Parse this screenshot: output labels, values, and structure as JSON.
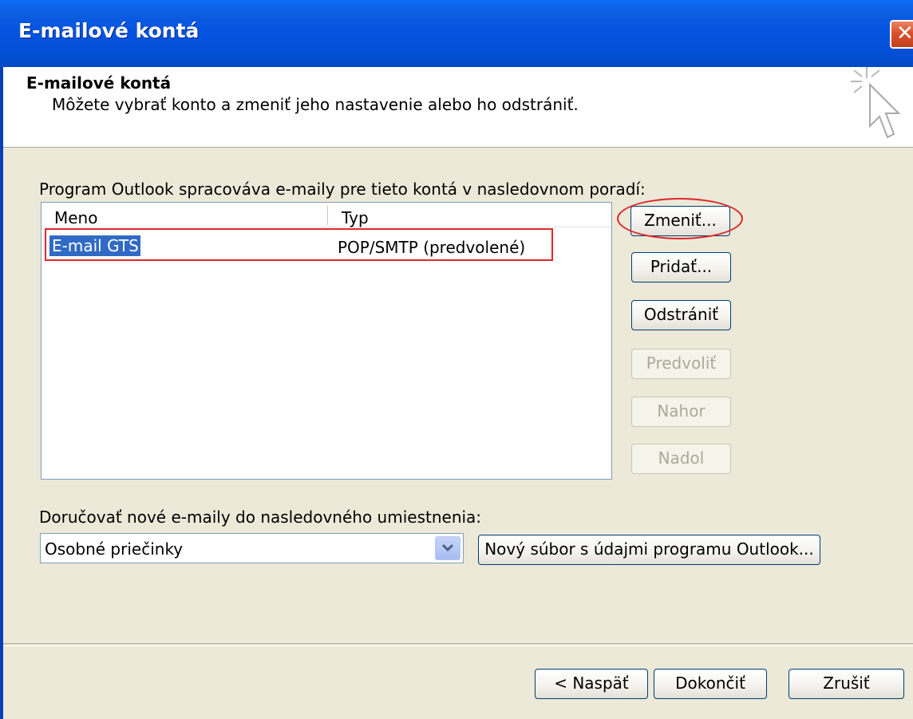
{
  "window": {
    "title": "E-mailové kontá"
  },
  "header": {
    "title": "E-mailové kontá",
    "subtitle": "Môžete vybrať konto a zmeniť jeho nastavenie alebo ho odstrániť."
  },
  "accounts": {
    "caption": "Program Outlook spracováva e-maily pre tieto kontá v nasledovnom poradí:",
    "columns": {
      "name": "Meno",
      "type": "Typ"
    },
    "rows": [
      {
        "name": "E-mail GTS",
        "type": "POP/SMTP (predvolené)",
        "selected": true
      }
    ]
  },
  "buttons": {
    "change": "Zmeniť...",
    "add": "Pridať...",
    "remove": "Odstrániť",
    "set_default": "Predvoliť",
    "up": "Nahor",
    "down": "Nadol"
  },
  "delivery": {
    "caption": "Doručovať nové e-maily do nasledovného umiestnenia:",
    "selected": "Osobné priečinky",
    "new_file_button": "Nový súbor s údajmi programu Outlook..."
  },
  "footer": {
    "back": "< Naspäť",
    "finish": "Dokončiť",
    "cancel": "Zrušiť"
  },
  "colors": {
    "titlebar": "#0554e1",
    "selection": "#316ac5",
    "annotation": "#e0262b",
    "dialog_bg": "#ece9d8"
  },
  "icons": {
    "wizard": "wizard-cursor-icon",
    "close": "close-icon",
    "dropdown": "chevron-down-icon"
  }
}
